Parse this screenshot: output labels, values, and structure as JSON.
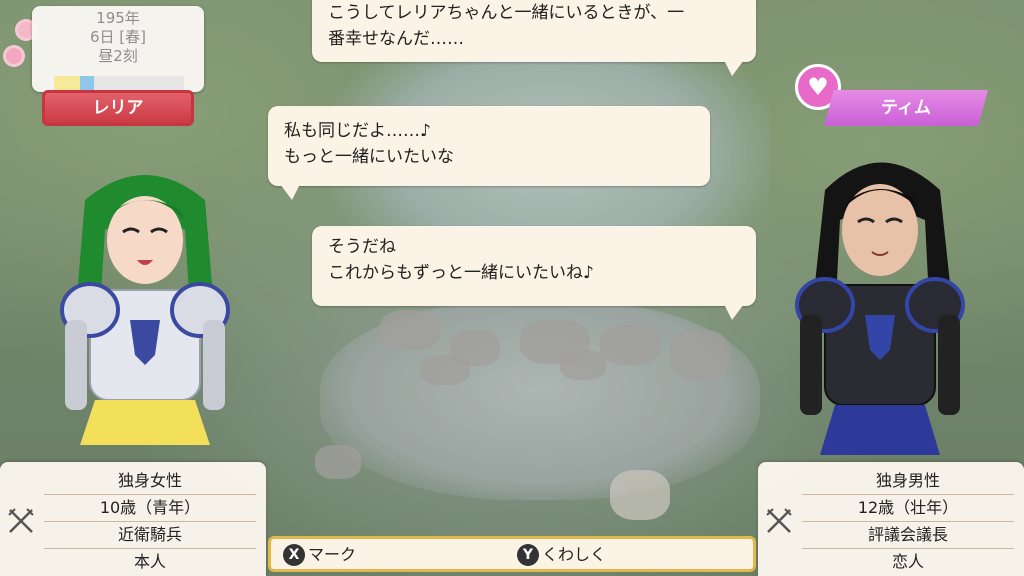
{
  "date": {
    "year": "195年",
    "day": "6日 [春]",
    "time": "昼2刻"
  },
  "left_character": {
    "name": "レリア",
    "info": [
      "独身女性",
      "10歳（青年）",
      "近衛騎兵",
      "本人"
    ]
  },
  "right_character": {
    "name": "ティム",
    "relation_icon": "heart-icon",
    "info": [
      "独身男性",
      "12歳（壮年）",
      "評議会議長",
      "恋人"
    ]
  },
  "dialogue": {
    "bubble1": {
      "line1": "こうしてレリアちゃんと一緒にいるときが、一",
      "line2": "番幸せなんだ……"
    },
    "bubble2": {
      "line1": "私も同じだよ……♪",
      "line2": "もっと一緒にいたいな"
    },
    "bubble3": {
      "line1": "そうだね",
      "line2": "これからもずっと一緒にいたいね♪"
    }
  },
  "hints": {
    "x_button": "X",
    "x_label": "マーク",
    "y_button": "Y",
    "y_label": "くわしく"
  },
  "colors": {
    "left_name_tag": "#cc3b44",
    "right_name_tag": "#c95fd6",
    "bubble_bg": "#fbf3e5",
    "hint_border": "#e2b84a"
  }
}
